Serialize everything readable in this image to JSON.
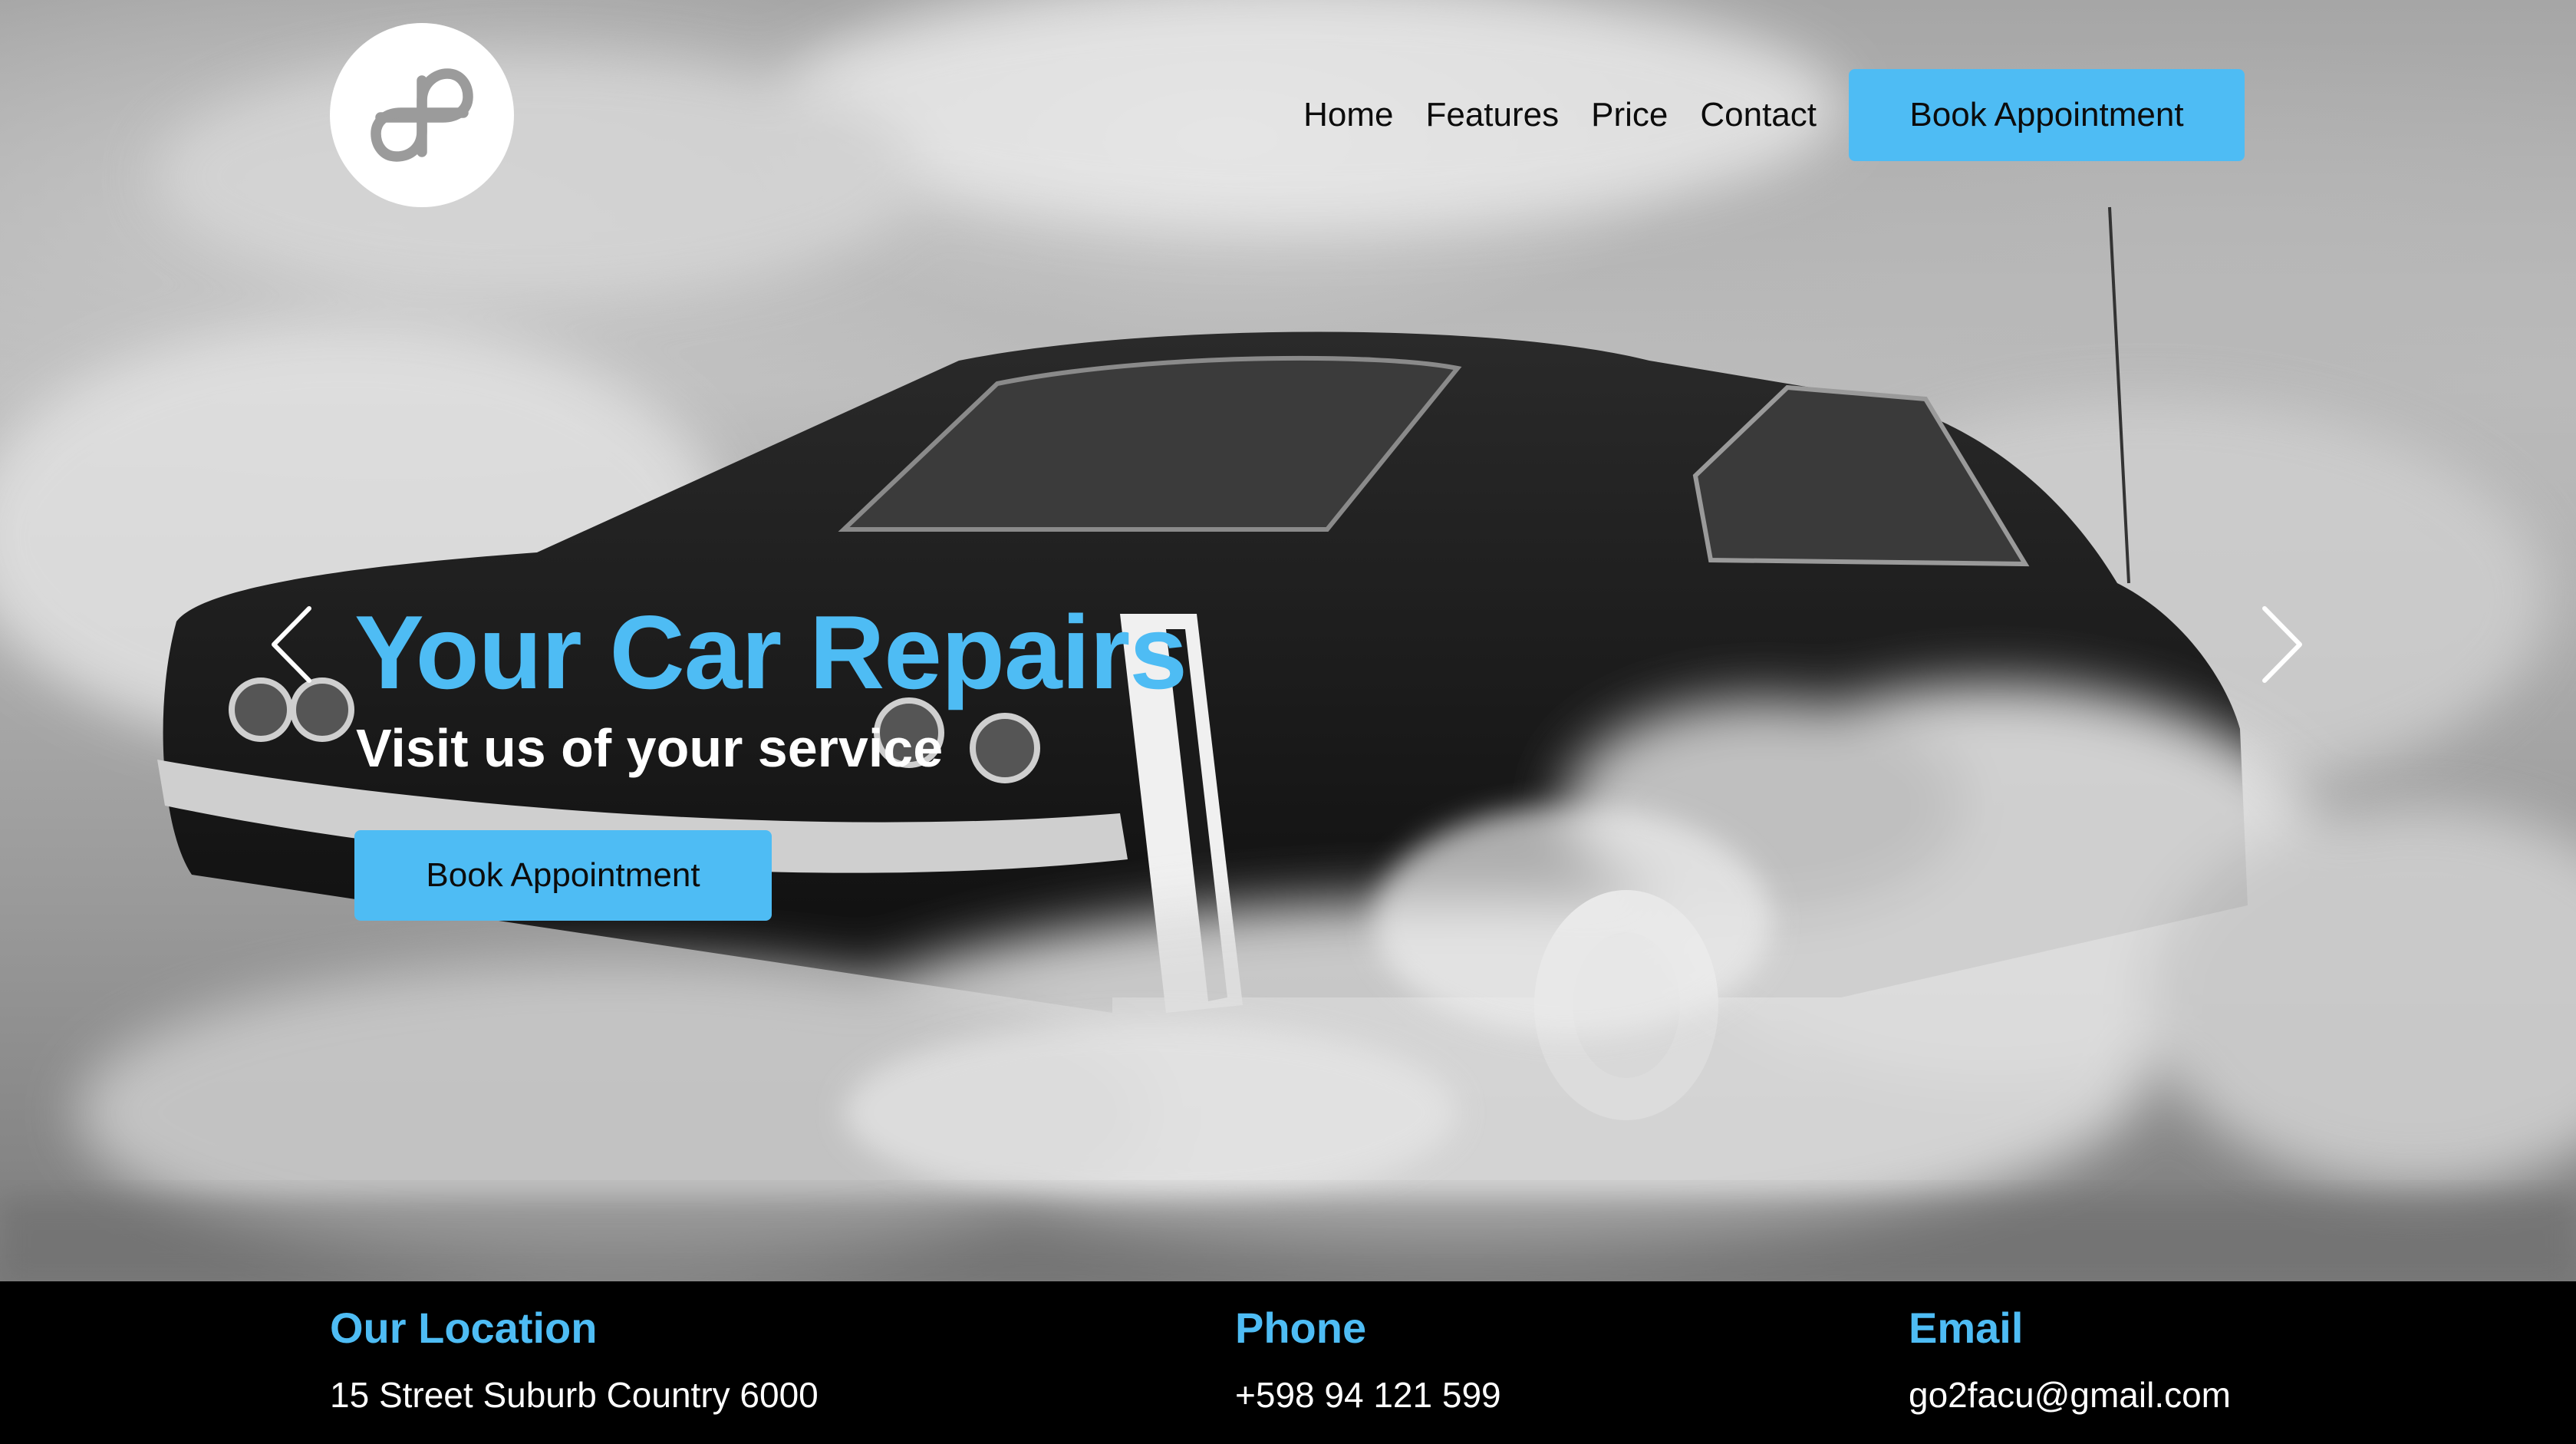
{
  "header": {
    "logo_icon": "double-loop-logo-icon",
    "nav": [
      {
        "label": "Home"
      },
      {
        "label": "Features"
      },
      {
        "label": "Price"
      },
      {
        "label": "Contact"
      }
    ],
    "cta_label": "Book Appointment"
  },
  "hero": {
    "title": "Your Car Repairs",
    "subtitle": "Visit us of your service",
    "cta_label": "Book Appointment",
    "prev_icon": "chevron-left-icon",
    "next_icon": "chevron-right-icon",
    "background": "black-and-white photo of muscle car in tire smoke"
  },
  "footer": {
    "location": {
      "heading": "Our Location",
      "value": "15 Street Suburb Country 6000"
    },
    "phone": {
      "heading": "Phone",
      "value": "+598 94 121 599"
    },
    "email": {
      "heading": "Email",
      "value": "go2facu@gmail.com"
    }
  },
  "colors": {
    "accent": "#4ebcf4",
    "footer_bg": "#000000",
    "hero_title": "#4ebcf4",
    "hero_subtitle": "#ffffff"
  }
}
